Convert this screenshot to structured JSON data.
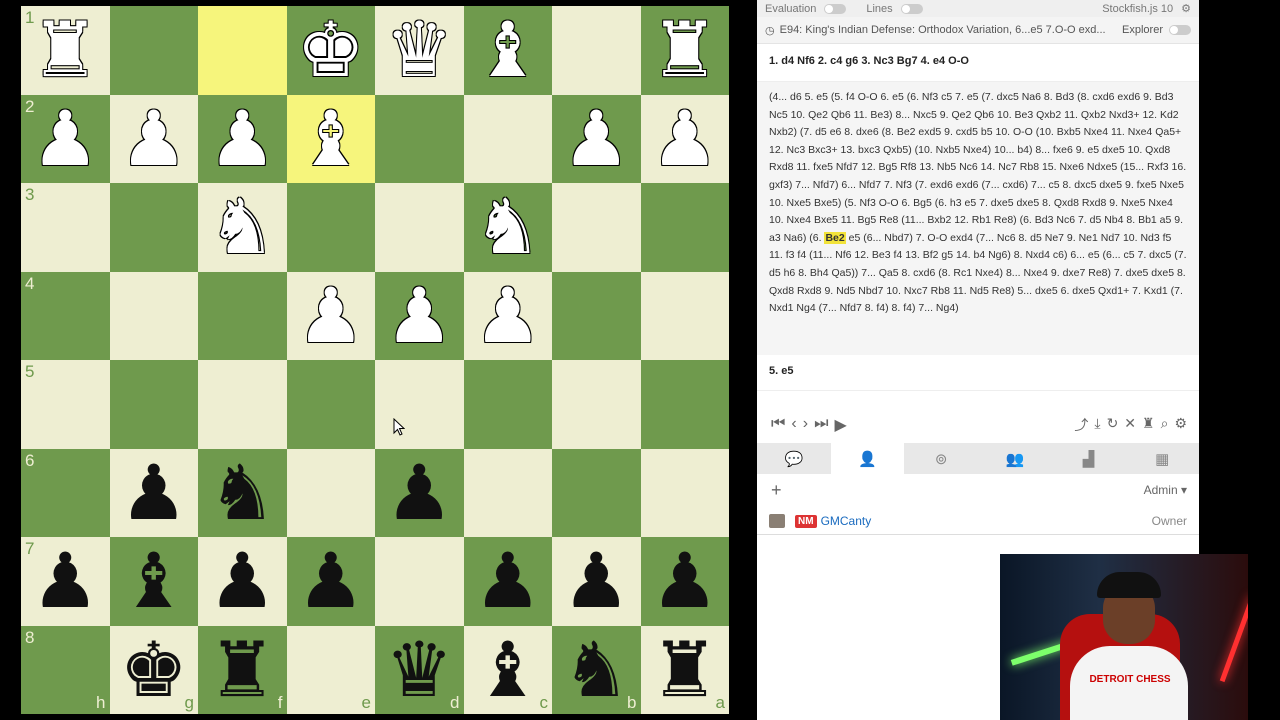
{
  "board": {
    "ranks": [
      "1",
      "2",
      "3",
      "4",
      "5",
      "6",
      "7",
      "8"
    ],
    "files": [
      "h",
      "g",
      "f",
      "e",
      "d",
      "c",
      "b",
      "a"
    ],
    "rows": [
      [
        "wR",
        "",
        "",
        "wK",
        "wQ",
        "wB",
        "",
        "wR"
      ],
      [
        "wP",
        "wP",
        "wP",
        "wB",
        "",
        "",
        "wP",
        "wP"
      ],
      [
        "",
        "",
        "wN",
        "",
        "",
        "wN",
        "",
        ""
      ],
      [
        "",
        "",
        "",
        "wP",
        "wP",
        "wP",
        "",
        ""
      ],
      [
        "",
        "",
        "",
        "",
        "",
        "",
        "",
        ""
      ],
      [
        "",
        "bP",
        "bN",
        "",
        "bP",
        "",
        "",
        ""
      ],
      [
        "bP",
        "bB",
        "bP",
        "bP",
        "",
        "bP",
        "bP",
        "bP"
      ],
      [
        "",
        "bK",
        "bR",
        "",
        "bQ",
        "bB",
        "bN",
        "bR"
      ]
    ],
    "highlights": [
      [
        0,
        2
      ],
      [
        1,
        3
      ]
    ],
    "colors": {
      "light": "#eeeed2",
      "dark": "#6f9a4d",
      "highlight": "#f6f57c"
    }
  },
  "topbar": {
    "evaluation_label": "Evaluation",
    "lines_label": "Lines",
    "engine_label": "Stockfish.js 10"
  },
  "opening": {
    "name": "E94: King's Indian Defense: Orthodox Variation, 6...e5 7.O-O exd...",
    "explorer_label": "Explorer"
  },
  "mainline": "1. d4 Nf6 2. c4 g6 3. Nc3 Bg7 4. e4 O-O",
  "variations": {
    "before": "(4... d6 5. e5 (5. f4 O-O 6. e5 (6. Nf3 c5 7. e5 (7. dxc5 Na6 8. Bd3 (8. cxd6 exd6 9. Bd3 Nc5 10. Qe2 Qb6 11. Be3) 8... Nxc5 9. Qe2 Qb6 10. Be3 Qxb2 11. Qxb2 Nxd3+ 12. Kd2 Nxb2) (7. d5 e6 8. dxe6 (8. Be2 exd5 9. cxd5 b5 10. O-O (10. Bxb5 Nxe4 11. Nxe4 Qa5+ 12. Nc3 Bxc3+ 13. bxc3 Qxb5) (10. Nxb5 Nxe4) 10... b4) 8... fxe6 9. e5 dxe5 10. Qxd8 Rxd8 11. fxe5 Nfd7 12. Bg5 Rf8 13. Nb5 Nc6 14. Nc7 Rb8 15. Nxe6 Ndxe5 (15... Rxf3 16. gxf3) 7... Nfd7) 6... Nfd7 7. Nf3 (7. exd6 exd6 (7... cxd6) 7... c5 8. dxc5 dxe5 9. fxe5 Nxe5 10. Nxe5 Bxe5) (5. Nf3 O-O 6. Bg5 (6. h3 e5 7. dxe5 dxe5 8. Qxd8 Rxd8 9. Nxe5 Nxe4 10. Nxe4 Bxe5 11. Bg5 Re8 (11... Bxb2 12. Rb1 Re8) (6. Bd3 Nc6 7. d5 Nb4 8. Bb1 a5 9. a3 Na6) (6.",
    "highlight": "Be2",
    "after": "e5 (6... Nbd7) 7. O-O exd4 (7... Nc6 8. d5 Ne7 9. Ne1 Nd7 10. Nd3 f5 11. f3 f4 (11... Nf6 12. Be3 f4 13. Bf2 g5 14. b4 Ng6) 8. Nxd4 c6) 6... e5 (6... c5 7. dxc5 (7. d5 h6 8. Bh4 Qa5)) 7... Qa5 8. cxd6 (8. Rc1 Nxe4) 8... Nxe4 9. dxe7 Re8) 7. dxe5 dxe5 8. Qxd8 Rxd8 9. Nd5 Nbd7 10. Nxc7 Rb8 11. Nd5 Re8) 5... dxe5 6. dxe5 Qxd1+ 7. Kxd1 (7. Nxd1 Ng4 (7... Nfd7 8. f4) 8. f4) 7... Ng4)"
  },
  "current_move": "5. e5",
  "controls": {
    "nav": [
      "|<",
      "<",
      ">",
      ">|",
      "▶"
    ],
    "tools": [
      "share",
      "download",
      "undo",
      "close",
      "tree",
      "analysis",
      "settings"
    ]
  },
  "tabs": [
    "chat",
    "members",
    "analysis",
    "group",
    "stats",
    "board"
  ],
  "members": {
    "add_label": "+",
    "admin_label": "Admin",
    "list": [
      {
        "title": "NM",
        "username": "GMCanty",
        "role": "Owner"
      }
    ]
  },
  "webcam": {
    "shirt_text": "DETROIT CHESS"
  }
}
